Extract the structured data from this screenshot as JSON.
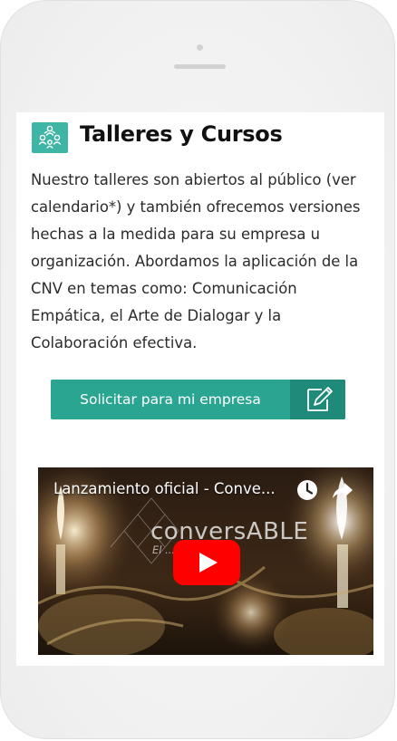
{
  "section": {
    "title": "Talleres y Cursos",
    "icon": "workshop-people-icon",
    "body": "Nuestro talleres son abiertos al público (ver calendario*) y también ofrecemos versiones hechas a la medida para su empresa u organización. Abordamos la aplicación de la CNV en temas como: Comunicación Empática, el Arte de Dialogar y la Colaboración efectiva."
  },
  "cta": {
    "label": "Solicitar para mi empresa",
    "icon": "edit-form-icon"
  },
  "video": {
    "title": "Lanzamiento oficial - Conve...",
    "brand": "conversABLE",
    "tagline": "El ... empatía",
    "icons": [
      "watch-later-icon",
      "share-icon",
      "youtube-play-icon"
    ]
  },
  "colors": {
    "accent": "#2aa592",
    "accent_dark": "#208a7a",
    "icon_bg": "#3fb5a6",
    "youtube_red": "#ff0000"
  }
}
